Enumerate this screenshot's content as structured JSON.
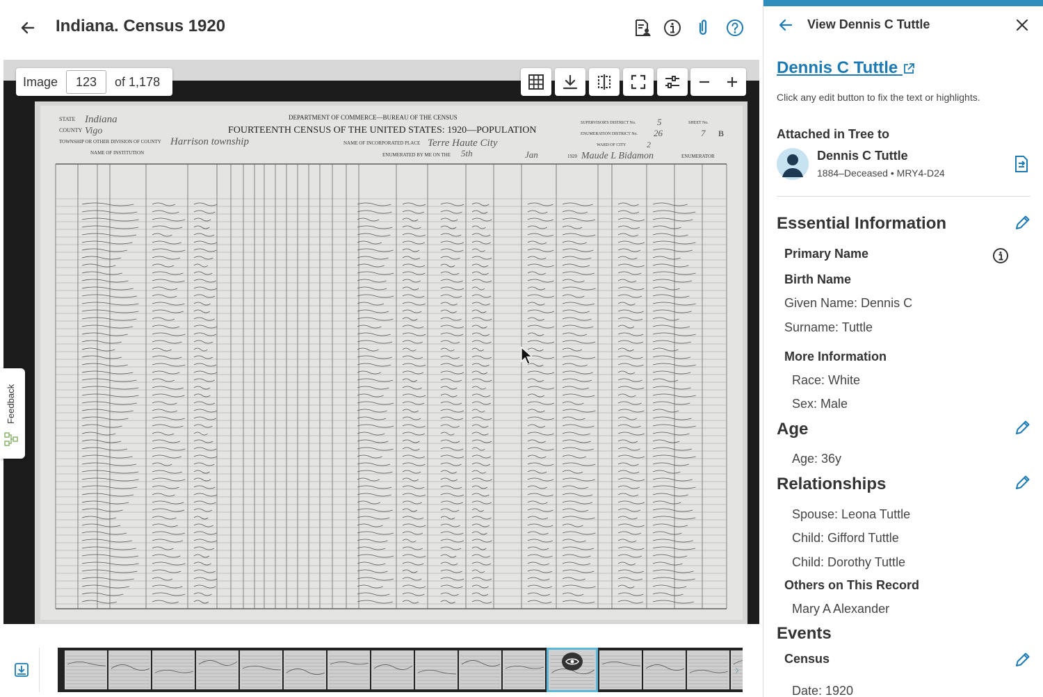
{
  "header": {
    "title": "Indiana. Census 1920",
    "icons": [
      "back-arrow-icon",
      "document-person-icon",
      "info-icon",
      "attachment-icon",
      "help-icon"
    ]
  },
  "viewer": {
    "image_label": "Image",
    "image_number": "123",
    "image_total": "of 1,178",
    "toolbar_icons": [
      "grid-icon",
      "download-icon",
      "compare-icon",
      "fullscreen-icon",
      "adjust-icon",
      "zoom-out-icon",
      "zoom-in-icon"
    ],
    "doc_header": {
      "dept": "DEPARTMENT OF COMMERCE—BUREAU OF THE CENSUS",
      "title": "FOURTEENTH CENSUS OF THE UNITED STATES: 1920—POPULATION",
      "state_label": "STATE",
      "state_value": "Indiana",
      "county_label": "COUNTY",
      "county_value": "Vigo",
      "township_label": "TOWNSHIP OR OTHER DIVISION OF COUNTY",
      "township_value": "Harrison township",
      "institution_label": "NAME OF INSTITUTION",
      "incorporated_label": "NAME OF INCORPORATED PLACE",
      "incorporated_value": "Terre Haute City",
      "enumerated_label": "ENUMERATED BY ME ON THE",
      "enumerated_day": "5th",
      "enumerated_month": "Jan",
      "enumerated_year": "1920",
      "enumerator": "Maude L Bidamon",
      "enumerator_label": "ENUMERATOR",
      "supervisor_label": "SUPERVISOR'S DISTRICT No.",
      "supervisor_value": "5",
      "enum_district_label": "ENUMERATION DISTRICT No.",
      "enum_district_value": "26",
      "ward_label": "WARD OF CITY",
      "ward_value": "2",
      "sheet_label": "SHEET No.",
      "sheet_value": "7",
      "sheet_side": "B"
    },
    "feedback": "Feedback"
  },
  "filmstrip": {
    "thumb_count": 16,
    "active_index": 11
  },
  "panel": {
    "title": "View Dennis C Tuttle",
    "person_name": "Dennis C Tuttle",
    "hint": "Click any edit button to fix the text or highlights.",
    "attached_label": "Attached in Tree to",
    "tree_person": {
      "name": "Dennis C Tuttle",
      "details": "1884–Deceased • MRY4-D24"
    },
    "essential": {
      "heading": "Essential Information",
      "primary_name": "Primary Name",
      "birth_name": "Birth Name",
      "given_name": "Given Name: Dennis C",
      "surname": "Surname: Tuttle",
      "more_info": "More Information",
      "race": "Race: White",
      "sex": "Sex: Male"
    },
    "age": {
      "heading": "Age",
      "value": "Age: 36y"
    },
    "relationships": {
      "heading": "Relationships",
      "items": [
        "Spouse: Leona Tuttle",
        "Child: Gifford Tuttle",
        "Child: Dorothy Tuttle"
      ],
      "others_heading": "Others on This Record",
      "others": [
        "Mary A Alexander"
      ]
    },
    "events": {
      "heading": "Events",
      "census": "Census",
      "date": "Date: 1920"
    }
  },
  "colors": {
    "link": "#1b7ab3",
    "panel_accent": "#2e8fbd",
    "thumb_active": "#5bb7d8"
  }
}
